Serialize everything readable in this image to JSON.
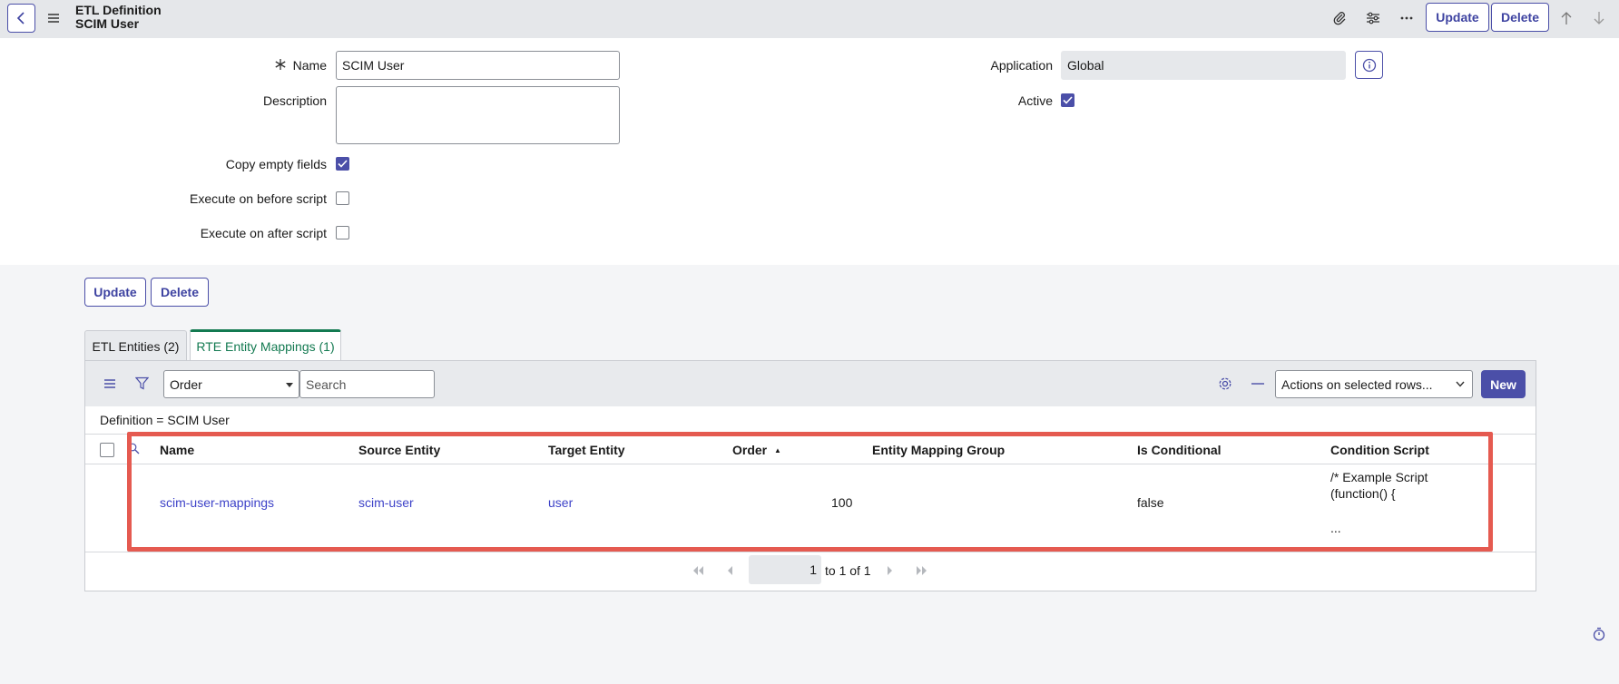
{
  "header": {
    "title_line1": "ETL Definition",
    "title_line2": "SCIM User",
    "update_label": "Update",
    "delete_label": "Delete"
  },
  "form": {
    "name_label": "Name",
    "name_value": "SCIM User",
    "description_label": "Description",
    "description_value": "",
    "copy_empty_label": "Copy empty fields",
    "copy_empty_checked": true,
    "exec_before_label": "Execute on before script",
    "exec_before_checked": false,
    "exec_after_label": "Execute on after script",
    "exec_after_checked": false,
    "application_label": "Application",
    "application_value": "Global",
    "active_label": "Active",
    "active_checked": true
  },
  "actions": {
    "update_label": "Update",
    "delete_label": "Delete"
  },
  "tabs": [
    {
      "label": "ETL Entities (2)",
      "active": false
    },
    {
      "label": "RTE Entity Mappings (1)",
      "active": true
    }
  ],
  "list": {
    "order_select": "Order",
    "search_placeholder": "Search",
    "actions_select": "Actions on selected rows...",
    "new_label": "New",
    "filter_text": "Definition = SCIM User",
    "columns": [
      "Name",
      "Source Entity",
      "Target Entity",
      "Order",
      "Entity Mapping Group",
      "Is Conditional",
      "Condition Script"
    ],
    "sort_indicator": "▲",
    "row": {
      "name": "scim-user-mappings",
      "source_entity": "scim-user",
      "target_entity": "user",
      "order": "100",
      "entity_mapping_group": "",
      "is_conditional": "false",
      "condition_script_line1": "/* Example Script",
      "condition_script_line2": "(function() {",
      "condition_script_line3": "..."
    },
    "pager": {
      "page": "1",
      "range_text": "to 1 of 1"
    }
  },
  "colors": {
    "accent": "#4b4fa8",
    "tab_active": "#137a51",
    "link": "#3e43c8",
    "highlight": "#e55a50"
  }
}
